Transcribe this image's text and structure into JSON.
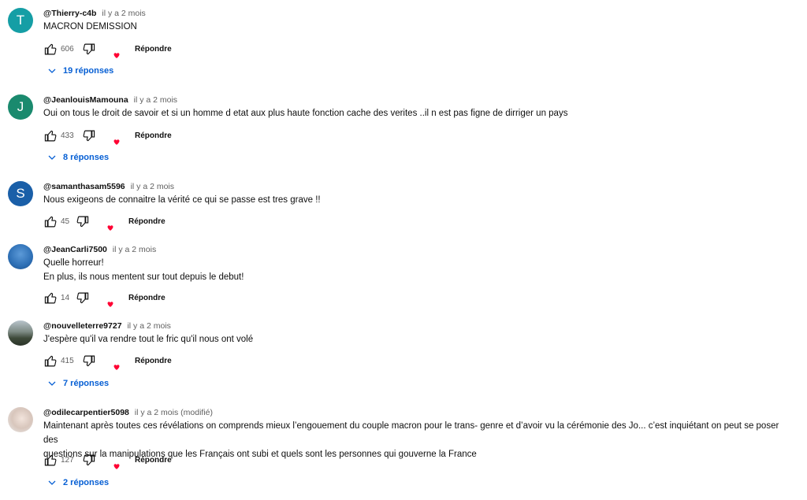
{
  "colors": {
    "link": "#065fd4",
    "meta": "#606060",
    "text": "#0f0f0f"
  },
  "labels": {
    "reply": "Répondre"
  },
  "comments": [
    {
      "avatar_letter": "T",
      "avatar_color": "#159ea5",
      "author": "@Thierry-c4b",
      "time": "il y a 2 mois",
      "lines": [
        "MACRON DEMISSION"
      ],
      "likes": "606",
      "replies": "19 réponses"
    },
    {
      "avatar_letter": "J",
      "avatar_color": "#1a8a6e",
      "author": "@JeanlouisMamouna",
      "time": "il y a 2 mois",
      "lines": [
        "Oui on tous le droit de savoir et si un homme d etat aux plus haute fonction cache des verites ..il n est pas figne de dirriger un pays"
      ],
      "likes": "433",
      "replies": "8 réponses"
    },
    {
      "avatar_letter": "S",
      "avatar_color": "#1a5fa8",
      "author": "@samanthasam5596",
      "time": "il y a 2 mois",
      "lines": [
        "Nous exigeons de connaitre la vérité ce qui se passe est tres grave !!"
      ],
      "likes": "45",
      "replies": ""
    },
    {
      "avatar_letter": "",
      "avatar_color": "#2f76bf",
      "author": "@JeanCarli7500",
      "time": "il y a 2 mois",
      "lines": [
        "Quelle horreur!",
        "En plus, ils nous mentent sur tout depuis le debut!"
      ],
      "likes": "14",
      "replies": ""
    },
    {
      "avatar_letter": "",
      "avatar_color": "#56606a",
      "author": "@nouvelleterre9727",
      "time": "il y a 2 mois",
      "lines": [
        "J'espère qu'il va rendre tout le fric qu'il nous ont volé"
      ],
      "likes": "415",
      "replies": "7 réponses"
    },
    {
      "avatar_letter": "",
      "avatar_color": "#d9d4d0",
      "author": "@odilecarpentier5098",
      "time": "il y a 2 mois (modifié)",
      "lines": [
        "Maintenant après toutes ces révélations on comprends mieux l’engouement du couple macron pour le trans- genre et d’avoir vu la cérémonie des Jo... c’est inquiétant on peut se poser des",
        "questions sur la manipulations que les Français ont subi et quels sont les personnes qui gouverne la France"
      ],
      "likes": "127",
      "replies": "2 réponses"
    }
  ]
}
